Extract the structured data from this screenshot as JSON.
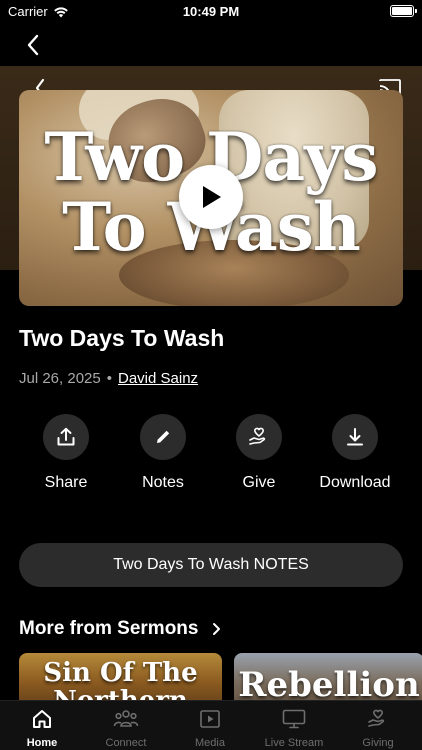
{
  "status_bar": {
    "carrier": "Carrier",
    "time": "10:49 PM"
  },
  "video": {
    "artwork_title": "Two Days To Wash",
    "play_icon": "play-icon"
  },
  "sermon": {
    "title": "Two Days To Wash",
    "date": "Jul 26, 2025",
    "separator": "•",
    "speaker": "David Sainz"
  },
  "actions": [
    {
      "label": "Share",
      "icon": "share-icon"
    },
    {
      "label": "Notes",
      "icon": "pencil-icon"
    },
    {
      "label": "Give",
      "icon": "give-hand-icon"
    },
    {
      "label": "Download",
      "icon": "download-icon"
    }
  ],
  "notes_button": {
    "label": "Two Days To Wash NOTES"
  },
  "more_section": {
    "title": "More from Sermons",
    "items": [
      {
        "artwork_title": "Sin Of The Northern"
      },
      {
        "artwork_title": "Rebellion"
      }
    ]
  },
  "tab_bar": {
    "tabs": [
      {
        "label": "Home",
        "icon": "home-icon",
        "active": true
      },
      {
        "label": "Connect",
        "icon": "people-icon",
        "active": false
      },
      {
        "label": "Media",
        "icon": "media-icon",
        "active": false
      },
      {
        "label": "Live Stream",
        "icon": "tv-icon",
        "active": false
      },
      {
        "label": "Giving",
        "icon": "give-hand-icon",
        "active": false
      }
    ]
  },
  "colors": {
    "background": "#000000",
    "surface": "#2c2c2c",
    "muted_text": "#a8a8a8",
    "hero_tint": "#3a2a18"
  }
}
